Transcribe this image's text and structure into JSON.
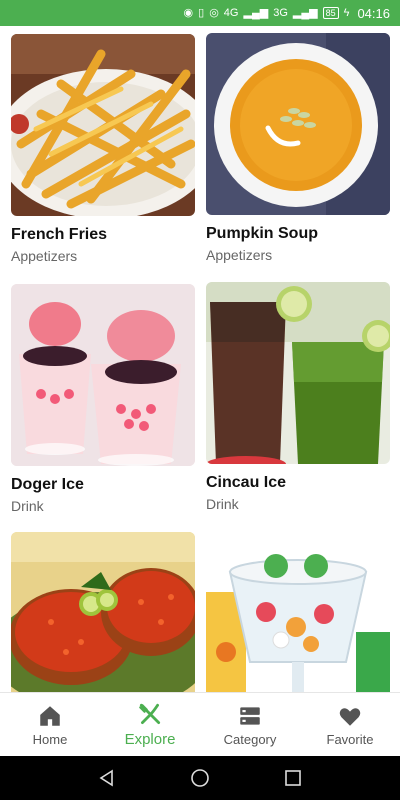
{
  "status_bar": {
    "time": "04:16",
    "battery": "85",
    "network_1": "4G",
    "network_2": "3G"
  },
  "recipes": [
    {
      "title": "French Fries",
      "category": "Appetizers",
      "image": "french-fries-image"
    },
    {
      "title": "Pumpkin Soup",
      "category": "Appetizers",
      "image": "pumpkin-soup-image"
    },
    {
      "title": "Doger Ice",
      "category": "Drink",
      "image": "doger-ice-image"
    },
    {
      "title": "Cincau Ice",
      "category": "Drink",
      "image": "cincau-ice-image"
    },
    {
      "title": "",
      "category": "",
      "image": "fried-tempeh-sambal-image"
    },
    {
      "title": "",
      "category": "",
      "image": "fruit-ice-dessert-image"
    }
  ],
  "bottom_nav": {
    "items": [
      {
        "label": "Home",
        "icon": "home-icon",
        "active": false
      },
      {
        "label": "Explore",
        "icon": "explore-icon",
        "active": true
      },
      {
        "label": "Category",
        "icon": "category-icon",
        "active": false
      },
      {
        "label": "Favorite",
        "icon": "heart-icon",
        "active": false
      }
    ],
    "active_color": "#4caf50",
    "inactive_color": "#555555"
  },
  "colors": {
    "status_bar": "#4caf50"
  }
}
